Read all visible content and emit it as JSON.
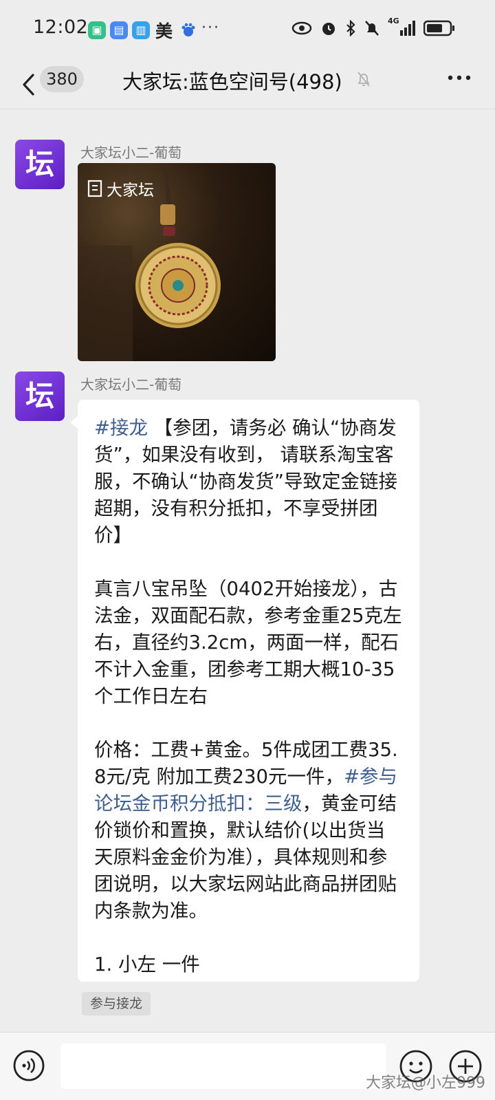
{
  "status_bar": {
    "time": "12:02",
    "meituan_label": "美",
    "more_indicator": "···",
    "network_label": "4G"
  },
  "nav": {
    "unread_count": "380",
    "title": "大家坛:蓝色空间号(498)"
  },
  "messages": [
    {
      "sender": "大家坛小二-葡萄",
      "avatar_text": "坛",
      "type": "image",
      "image_watermark": "大家坛"
    },
    {
      "sender": "大家坛小二-葡萄",
      "avatar_text": "坛",
      "type": "text",
      "p1_tag": "#接龙",
      "p1_text": " 【参团，请务必 确认“协商发货”，如果没有收到， 请联系淘宝客服，不确认“协商发货”导致定金链接超期，没有积分抵扣，不享受拼团价】",
      "p2_text": "真言八宝吊坠（0402开始接龙），古法金，双面配石款，参考金重25克左右，直径约3.2cm，两面一样，配石不计入金重，团参考工期大概10-35个工作日左右",
      "p3_text_a": "价格：工费+黄金。5件成团工费35.8元/克 附加工费230元一件，",
      "p3_tag": "#参与论坛金币积分抵扣：三级",
      "p3_text_b": "，黄金可结价锁价和置换，默认结价(以出货当天原料金金价为准），具体规则和参团说明，以大家坛网站此商品拼团贴内条款为准。",
      "p4_text": "1. 小左  一件"
    }
  ],
  "join_chip_label": "参与接龙",
  "watermark": "大家坛@小左999",
  "colors": {
    "background": "#ededed",
    "link": "#3f5f90",
    "avatar_gradient": [
      "#8a48e6",
      "#5d1fc4"
    ]
  }
}
